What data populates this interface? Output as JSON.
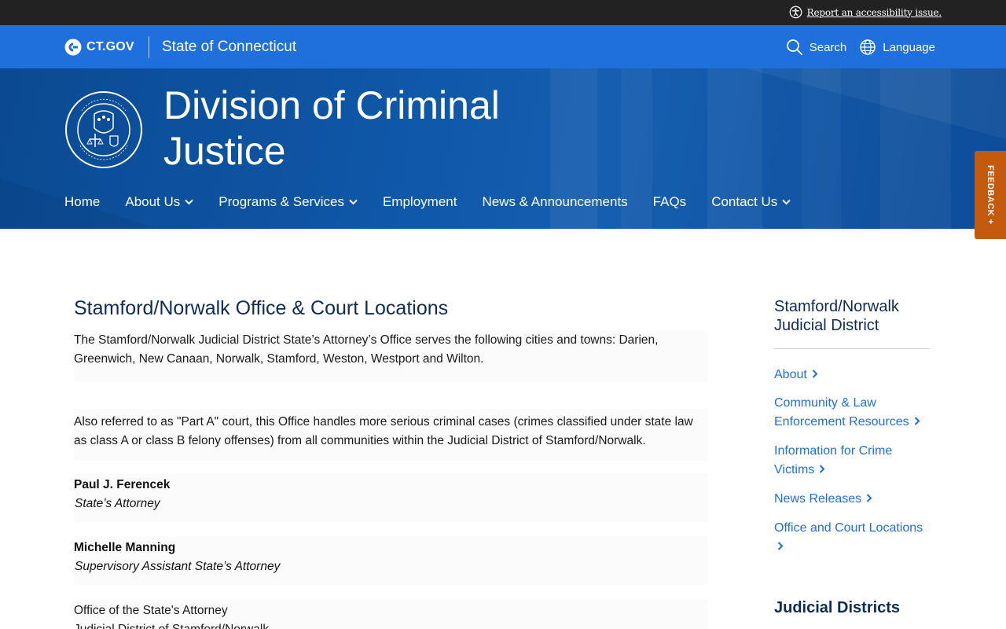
{
  "utility": {
    "accessibility_link": "Report an accessibility issue."
  },
  "ctgov": {
    "logo_text": "CT.GOV",
    "state_name": "State of Connecticut",
    "search_label": "Search",
    "language_label": "Language"
  },
  "hero": {
    "title": "Division of Criminal Justice",
    "nav": [
      {
        "label": "Home",
        "has_menu": false
      },
      {
        "label": "About Us",
        "has_menu": true
      },
      {
        "label": "Programs & Services",
        "has_menu": true
      },
      {
        "label": "Employment",
        "has_menu": false
      },
      {
        "label": "News & Announcements",
        "has_menu": false
      },
      {
        "label": "FAQs",
        "has_menu": false
      },
      {
        "label": "Contact Us",
        "has_menu": true
      }
    ]
  },
  "feedback": {
    "label": "FEEDBACK +"
  },
  "main": {
    "title": "Stamford/Norwalk Office & Court Locations",
    "intro": "The Stamford/Norwalk Judicial District State’s Attorney’s Office serves the following cities and towns: Darien, Greenwich, New Canaan, Norwalk, Stamford, Weston, Westport and Wilton.",
    "part_a": "Also referred to as \"Part A\" court, this Office handles more serious criminal cases (crimes classified under state law as class A or class B felony offenses) from all communities within the Judicial District of Stamford/Norwalk.",
    "people": [
      {
        "name": "Paul J. Ferencek",
        "title": "State’s Attorney"
      },
      {
        "name": "Michelle Manning",
        "title": "Supervisory Assistant State’s Attorney"
      }
    ],
    "office_line1": "Office of the State's Attorney",
    "office_line2": "Judicial District of Stamford/Norwalk"
  },
  "sidebar": {
    "heading": "Stamford/Norwalk Judicial District",
    "links": [
      {
        "label": "About"
      },
      {
        "label": "Community & Law Enforcement Resources"
      },
      {
        "label": "Information for Crime Victims"
      },
      {
        "label": "News Releases"
      },
      {
        "label": "Office and Court Locations"
      }
    ],
    "heading2": "Judicial Districts"
  },
  "icons": {
    "accessibility": "accessibility-icon",
    "search": "search-icon",
    "language": "globe-icon",
    "chevron": "chevron-down-icon",
    "side_chevron": "chevron-right-icon"
  }
}
